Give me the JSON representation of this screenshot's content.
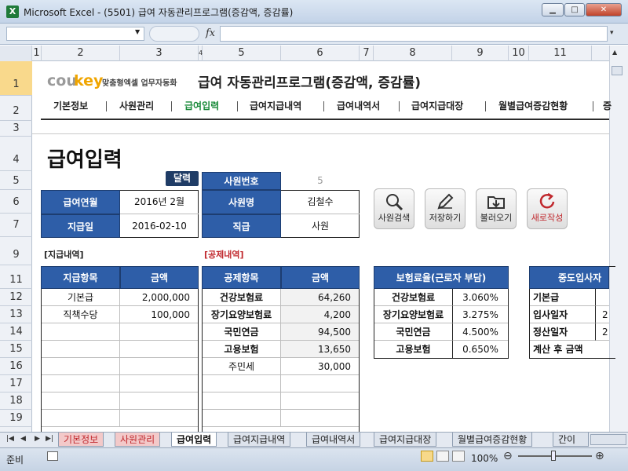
{
  "window": {
    "title": "Microsoft Excel - (5501) 급여 자동관리프로그램(증감액, 증감률)",
    "app_icon": "excel-icon"
  },
  "formula_bar": {
    "fx": "fx",
    "name_box": "",
    "formula": ""
  },
  "columns": [
    "1",
    "2",
    "3",
    "4",
    "5",
    "6",
    "7",
    "8",
    "9",
    "10",
    "11"
  ],
  "rows": [
    "1",
    "2",
    "3",
    "4",
    "5",
    "6",
    "7",
    "9",
    "11",
    "12",
    "13",
    "14",
    "15",
    "16",
    "17",
    "18",
    "19"
  ],
  "logo": {
    "cou": "cou",
    "key": "key",
    "sub": "맞춤형엑셀 업무자동화"
  },
  "top_title": "급여 자동관리프로그램(증감액, 증감률)",
  "nav": [
    {
      "label": "기본정보"
    },
    {
      "label": "사원관리"
    },
    {
      "label": "급여입력"
    },
    {
      "label": "급여지급내역"
    },
    {
      "label": "급여내역서"
    },
    {
      "label": "급여지급대장"
    },
    {
      "label": "월별급여증감현황"
    },
    {
      "label": "증"
    }
  ],
  "page_title": "급여입력",
  "dalryeok_button": "달력",
  "pay_info": {
    "year_month_label": "급여연월",
    "year_month_value": "2016년  2월",
    "pay_date_label": "지급일",
    "pay_date_value": "2016-02-10"
  },
  "employee": {
    "number_label": "사원번호",
    "number_value": "5",
    "name_label": "사원명",
    "name_value": "김철수",
    "grade_label": "직급",
    "grade_value": "사원"
  },
  "buttons": {
    "search": "사원검색",
    "save": "저장하기",
    "load": "불러오기",
    "new": "새로작성"
  },
  "section_pay": "[지급내역]",
  "section_deduct": "[공제내역]",
  "pay_table": {
    "headers": [
      "지급항목",
      "금액"
    ],
    "rows": [
      [
        "기본급",
        "2,000,000"
      ],
      [
        "직책수당",
        "100,000"
      ]
    ]
  },
  "deduct_table": {
    "headers": [
      "공제항목",
      "금액"
    ],
    "rows": [
      [
        "건강보험료",
        "64,260"
      ],
      [
        "장기요양보험료",
        "4,200"
      ],
      [
        "국민연금",
        "94,500"
      ],
      [
        "고용보험",
        "13,650"
      ],
      [
        "주민세",
        "30,000"
      ]
    ]
  },
  "insurance_table": {
    "header": "보험료율(근로자 부담)",
    "rows": [
      [
        "건강보험료",
        "3.060%"
      ],
      [
        "장기요양보험료",
        "3.275%"
      ],
      [
        "국민연금",
        "4.500%"
      ],
      [
        "고용보험",
        "0.650%"
      ]
    ]
  },
  "midjoin_table": {
    "header": "중도입사자",
    "rows": [
      [
        "기본급",
        ""
      ],
      [
        "입사일자",
        "2"
      ],
      [
        "정산일자",
        "2"
      ],
      [
        "계산 후 금액",
        ""
      ]
    ]
  },
  "sheet_tabs": [
    "기본정보",
    "사원관리",
    "급여입력",
    "급여지급내역",
    "급여내역서",
    "급여지급대장",
    "월별급여증감현황",
    "간이"
  ],
  "status": {
    "ready": "준비",
    "zoom": "100%"
  }
}
